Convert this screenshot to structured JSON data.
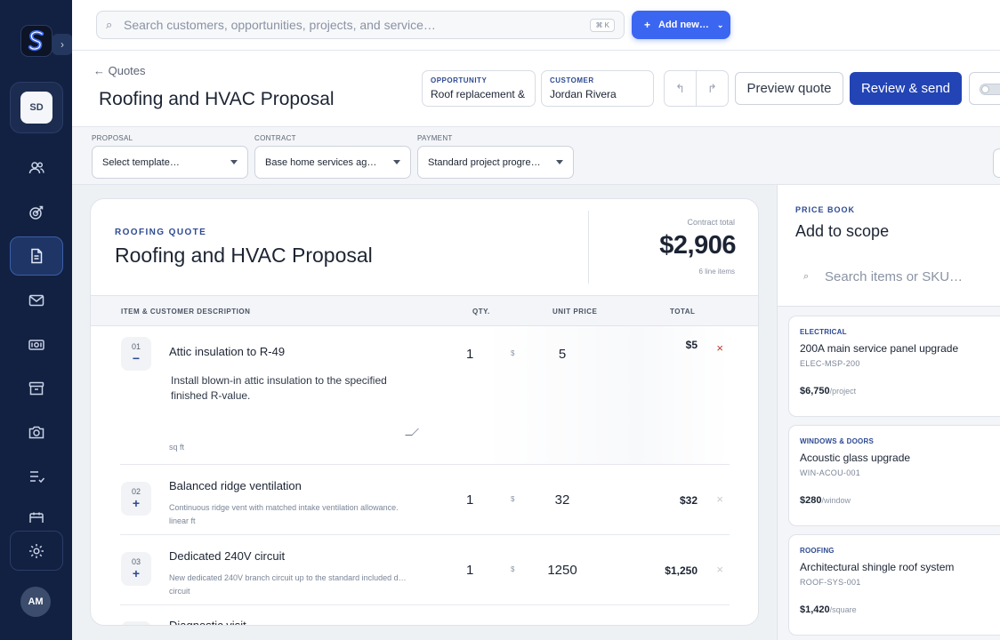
{
  "topbar": {
    "search_placeholder": "Search customers, opportunities, projects, and service…",
    "shortcut": "⌘ K",
    "add_new_label": "Add new…"
  },
  "sidebar": {
    "workspace_initials": "SD",
    "user_initials": "AM",
    "nav_icons": [
      "users-icon",
      "target-icon",
      "document-icon",
      "mail-icon",
      "money-icon",
      "archive-icon",
      "camera-icon",
      "checklist-icon",
      "calendar-icon"
    ],
    "active_item": "document-icon"
  },
  "header": {
    "back_label": "← Quotes",
    "title": "Roofing and HVAC Proposal",
    "opportunity_label": "OPPORTUNITY",
    "opportunity_value": "Roof replacement &",
    "customer_label": "CUSTOMER",
    "customer_value": "Jordan Rivera",
    "preview_label": "Preview quote",
    "review_label": "Review & send"
  },
  "selectors": {
    "proposal_label": "PROPOSAL",
    "proposal_value": "Select template…",
    "contract_label": "CONTRACT",
    "contract_value": "Base home services ag…",
    "payment_label": "PAYMENT",
    "payment_value": "Standard project progre…"
  },
  "quote": {
    "eyebrow": "ROOFING QUOTE",
    "title": "Roofing and HVAC Proposal",
    "total_label": "Contract total",
    "total": "$2,906",
    "count": "6 line items",
    "columns": {
      "item": "ITEM & CUSTOMER DESCRIPTION",
      "qty": "QTY.",
      "unit_price": "UNIT PRICE",
      "total": "TOTAL"
    },
    "currency_symbol": "$",
    "remove_symbol": "×",
    "lines": [
      {
        "index": "01",
        "toggle": "−",
        "name": "Attic insulation to R-49",
        "description": "Install blown-in attic insulation to the specified finished R-value.",
        "unit": "sq ft",
        "qty": "1",
        "unit_price": "5",
        "total": "$5"
      },
      {
        "index": "02",
        "toggle": "+",
        "name": "Balanced ridge ventilation",
        "description": "Continuous ridge vent with matched intake ventilation allowance.",
        "unit": "linear ft",
        "qty": "1",
        "unit_price": "32",
        "total": "$32"
      },
      {
        "index": "03",
        "toggle": "+",
        "name": "Dedicated 240V circuit",
        "description": "New dedicated 240V branch circuit up to the standard included d…",
        "unit": "circuit",
        "qty": "1",
        "unit_price": "1250",
        "total": "$1,250"
      },
      {
        "index": "",
        "toggle": "",
        "name": "Diagnostic visit",
        "description": "",
        "unit": "",
        "qty": "",
        "unit_price": "",
        "total": ""
      }
    ]
  },
  "pricebook": {
    "eyebrow": "PRICE BOOK",
    "title": "Add to scope",
    "search_placeholder": "Search items or SKU…",
    "items": [
      {
        "category": "ELECTRICAL",
        "name": "200A main service panel upgrade",
        "sku": "ELEC-MSP-200",
        "price": "$6,750",
        "per": "/project"
      },
      {
        "category": "WINDOWS & DOORS",
        "name": "Acoustic glass upgrade",
        "sku": "WIN-ACOU-001",
        "price": "$280",
        "per": "/window"
      },
      {
        "category": "ROOFING",
        "name": "Architectural shingle roof system",
        "sku": "ROOF-SYS-001",
        "price": "$1,420",
        "per": "/square"
      }
    ]
  },
  "colors": {
    "sidebar": "#122142",
    "accent": "#3b66f1",
    "primary_button": "#2344b5",
    "remove_active": "#c0392b",
    "remove_muted": "#c5cad3"
  }
}
